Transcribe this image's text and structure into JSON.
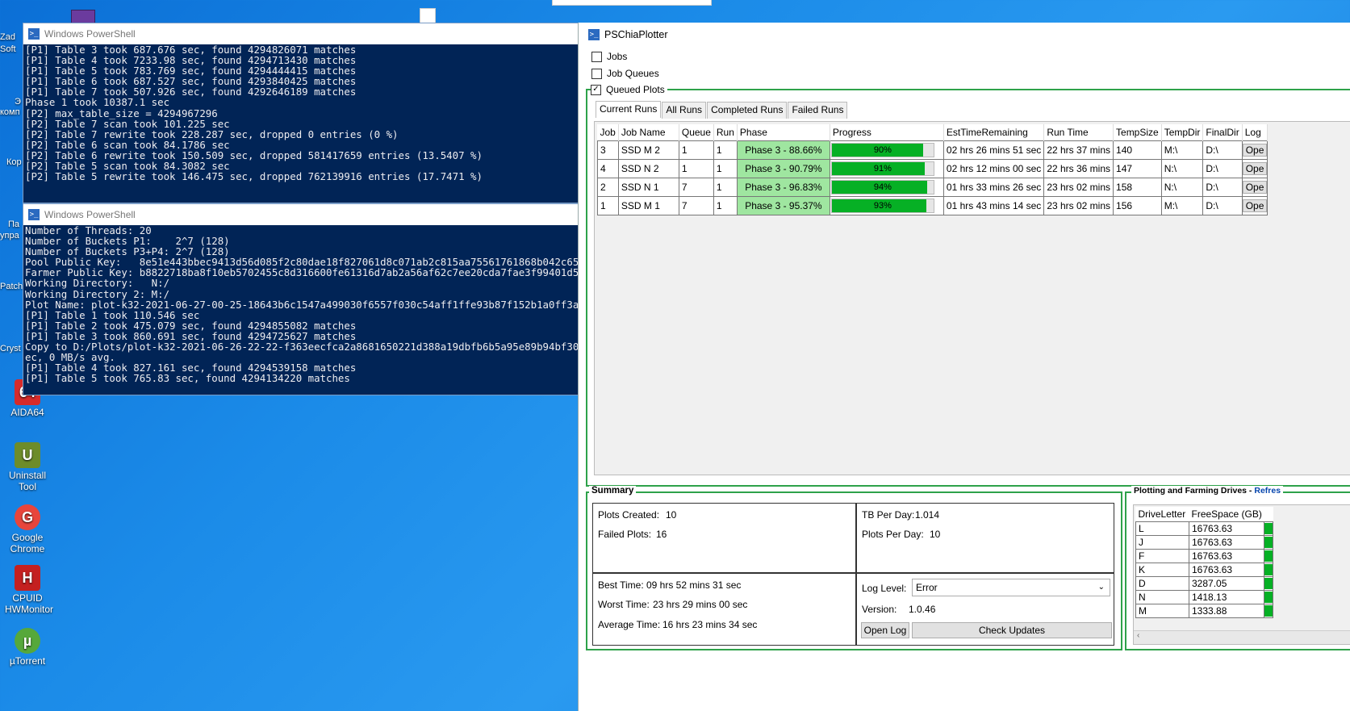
{
  "desktop": {
    "icons": [
      {
        "label": "AIDA64",
        "color": "#d62b2b",
        "glyph": "64"
      },
      {
        "label": "Uninstall Tool",
        "color": "#6d8c2a",
        "glyph": "U"
      },
      {
        "label": "Google Chrome",
        "color": "#e8453c",
        "glyph": "G"
      },
      {
        "label": "CPUID HWMonitor",
        "color": "#c42020",
        "glyph": "H"
      },
      {
        "label": "µTorrent",
        "color": "#56a83b",
        "glyph": "µ"
      }
    ],
    "fragments": [
      "Zad",
      "Soft",
      "Э",
      "комп",
      "Кор",
      "Па",
      "упра",
      "Patch",
      "Cryst"
    ]
  },
  "powershell_top": {
    "title": "Windows PowerShell",
    "lines": [
      "[P1] Table 3 took 687.676 sec, found 4294826071 matches",
      "[P1] Table 4 took 7233.98 sec, found 4294713430 matches",
      "[P1] Table 5 took 783.769 sec, found 4294444415 matches",
      "[P1] Table 6 took 687.527 sec, found 4293840425 matches",
      "[P1] Table 7 took 507.926 sec, found 4292646189 matches",
      "Phase 1 took 10387.1 sec",
      "[P2] max_table_size = 4294967296",
      "[P2] Table 7 scan took 101.225 sec",
      "[P2] Table 7 rewrite took 228.287 sec, dropped 0 entries (0 %)",
      "[P2] Table 6 scan took 84.1786 sec",
      "[P2] Table 6 rewrite took 150.509 sec, dropped 581417659 entries (13.5407 %)",
      "[P2] Table 5 scan took 84.3082 sec",
      "[P2] Table 5 rewrite took 146.475 sec, dropped 762139916 entries (17.7471 %)"
    ]
  },
  "powershell_bottom": {
    "title": "Windows PowerShell",
    "lines": [
      "Number of Threads: 20",
      "Number of Buckets P1:    2^7 (128)",
      "Number of Buckets P3+P4: 2^7 (128)",
      "Pool Public Key:   8e51e443bbec9413d56d085f2c80dae18f827061d8c071ab2c815aa75561761868b042c65",
      "Farmer Public Key: b8822718ba8f10eb5702455c8d316600fe61316d7ab2a56af62c7ee20cda7fae3f99401d5",
      "Working Directory:   N:/",
      "Working Directory 2: M:/",
      "Plot Name: plot-k32-2021-06-27-00-25-18643b6c1547a499030f6557f030c54aff1ffe93b87f152b1a0ff3a",
      "[P1] Table 1 took 110.546 sec",
      "[P1] Table 2 took 475.079 sec, found 4294855082 matches",
      "[P1] Table 3 took 860.691 sec, found 4294725627 matches",
      "Copy to D:/Plots/plot-k32-2021-06-26-22-22-f363eecfca2a8681650221d388a19dbfb6b5a95e89b94bf30",
      "ec, 0 MB/s avg.",
      "[P1] Table 4 took 827.161 sec, found 4294539158 matches",
      "[P1] Table 5 took 765.83 sec, found 4294134220 matches"
    ]
  },
  "chia": {
    "title": "PSChiaPlotter",
    "checkboxes": [
      {
        "label": "Jobs",
        "checked": false
      },
      {
        "label": "Job Queues",
        "checked": false
      },
      {
        "label": "Queued Plots",
        "checked": true
      }
    ],
    "tabs": [
      "Current Runs",
      "All Runs",
      "Completed Runs",
      "Failed Runs"
    ],
    "active_tab": 0,
    "columns": [
      "Job",
      "Job Name",
      "Queue",
      "Run",
      "Phase",
      "Progress",
      "EstTimeRemaining",
      "Run Time",
      "TempSize",
      "TempDir",
      "FinalDir",
      "Log"
    ],
    "rows": [
      {
        "job": "3",
        "name": "SSD M 2",
        "queue": "1",
        "run": "1",
        "phase": "Phase 3 - 88.66%",
        "progress": 90,
        "progress_label": "90%",
        "est": "02 hrs 26 mins 51 sec",
        "runtime": "22 hrs 37 mins",
        "tempsize": "140",
        "tempdir": "M:\\",
        "finaldir": "D:\\",
        "log": "Ope"
      },
      {
        "job": "4",
        "name": "SSD N 2",
        "queue": "1",
        "run": "1",
        "phase": "Phase 3 - 90.79%",
        "progress": 91,
        "progress_label": "91%",
        "est": "02 hrs 12 mins 00 sec",
        "runtime": "22 hrs 36 mins",
        "tempsize": "147",
        "tempdir": "N:\\",
        "finaldir": "D:\\",
        "log": "Ope"
      },
      {
        "job": "2",
        "name": "SSD N 1",
        "queue": "7",
        "run": "1",
        "phase": "Phase 3 - 96.83%",
        "progress": 94,
        "progress_label": "94%",
        "est": "01 hrs 33 mins 26 sec",
        "runtime": "23 hrs 02 mins",
        "tempsize": "158",
        "tempdir": "N:\\",
        "finaldir": "D:\\",
        "log": "Ope"
      },
      {
        "job": "1",
        "name": "SSD M 1",
        "queue": "7",
        "run": "1",
        "phase": "Phase 3 - 95.37%",
        "progress": 93,
        "progress_label": "93%",
        "est": "01 hrs 43 mins 14 sec",
        "runtime": "23 hrs 02 mins",
        "tempsize": "156",
        "tempdir": "M:\\",
        "finaldir": "D:\\",
        "log": "Ope"
      }
    ],
    "summary": {
      "legend": "Summary",
      "plots_created_label": "Plots Created:",
      "plots_created": "10",
      "failed_plots_label": "Failed Plots:",
      "failed_plots": "16",
      "tb_per_day_label": "TB Per Day:",
      "tb_per_day": "1.014",
      "plots_per_day_label": "Plots Per Day:",
      "plots_per_day": "10",
      "best_time_label": "Best Time:",
      "best_time": "09 hrs 52 mins 31 sec",
      "worst_time_label": "Worst Time:",
      "worst_time": "23 hrs 29 mins 00 sec",
      "avg_time_label": "Average Time:",
      "avg_time": "16 hrs 23 mins 34 sec",
      "log_level_label": "Log Level:",
      "log_level": "Error",
      "version_label": "Version:",
      "version": "1.0.46",
      "open_log_label": "Open Log",
      "check_updates_label": "Check Updates"
    },
    "drives": {
      "legend": "Plotting and Farming Drives -",
      "refresh_label": "Refres",
      "columns": [
        "DriveLetter",
        "FreeSpace (GB)"
      ],
      "rows": [
        {
          "letter": "L",
          "free": "16763.63"
        },
        {
          "letter": "J",
          "free": "16763.63"
        },
        {
          "letter": "F",
          "free": "16763.63"
        },
        {
          "letter": "K",
          "free": "16763.63"
        },
        {
          "letter": "D",
          "free": "3287.05"
        },
        {
          "letter": "N",
          "free": "1418.13"
        },
        {
          "letter": "M",
          "free": "1333.88"
        }
      ]
    },
    "colors": {
      "accent_green": "#2ea24a",
      "progress_green": "#06b025",
      "phase_bg": "#9fe6a0",
      "ps_bg": "#012456"
    }
  }
}
